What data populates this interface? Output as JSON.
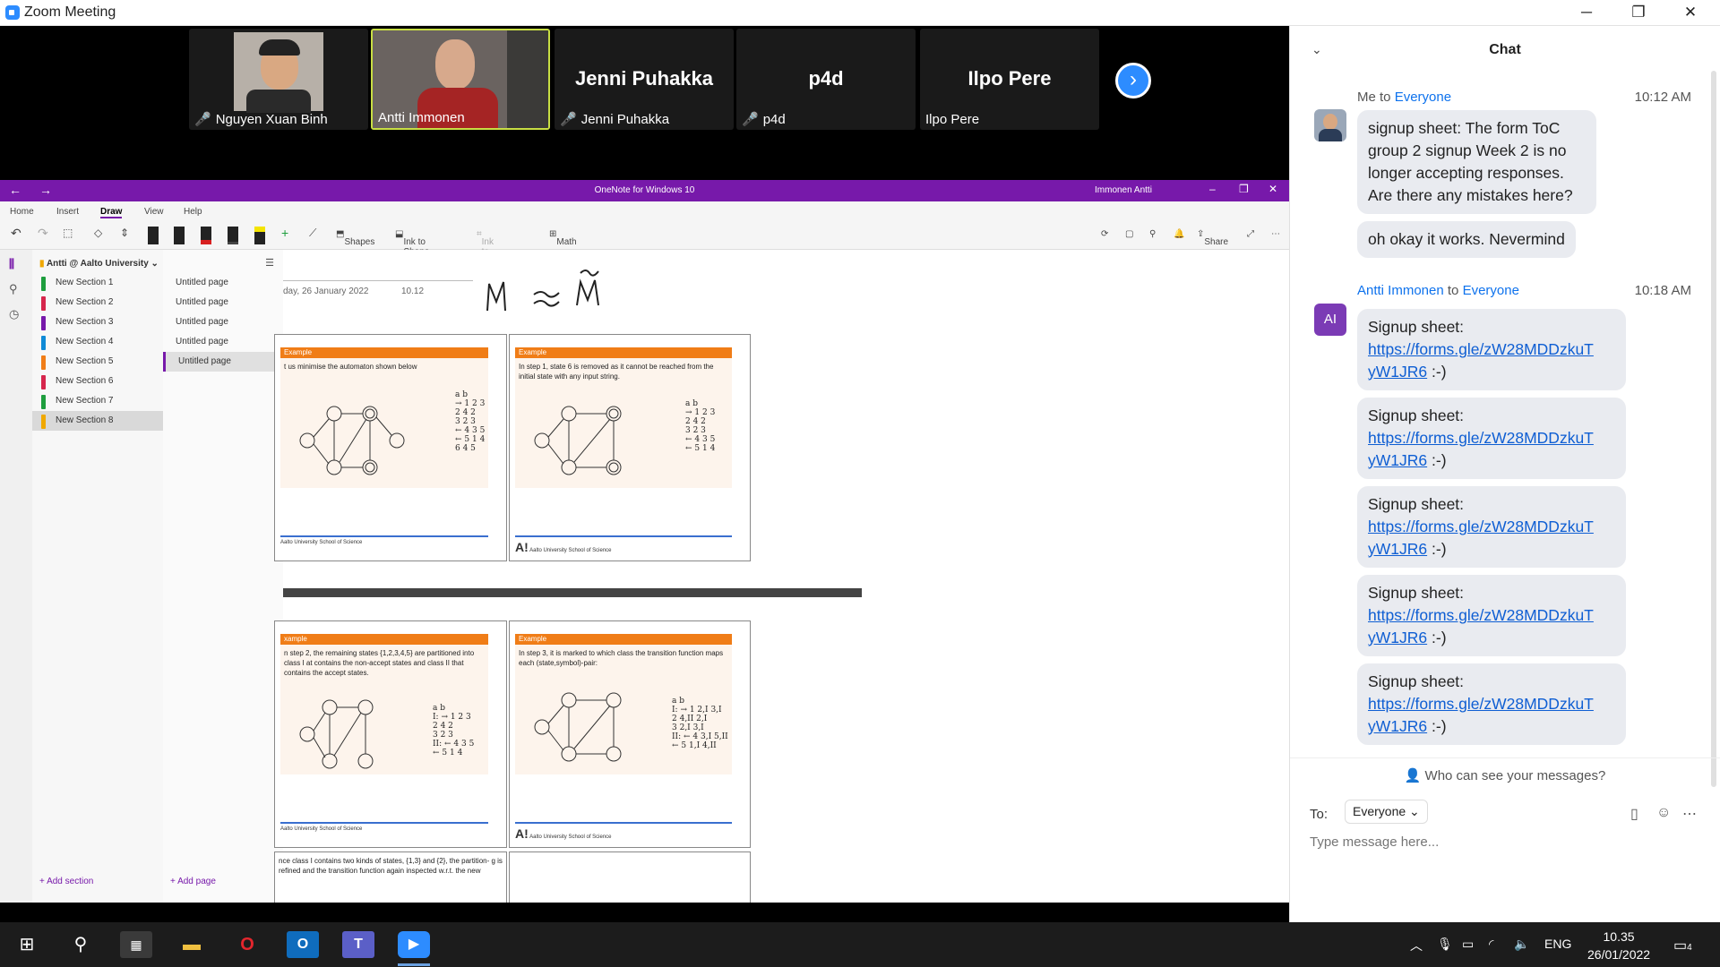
{
  "window": {
    "title": "Zoom Meeting",
    "min": "─",
    "max": "❐",
    "close": "✕"
  },
  "participants": [
    {
      "name": "Nguyen Xuan Binh",
      "display": "",
      "muted": true,
      "video": true
    },
    {
      "name": "Antti Immonen",
      "display": "",
      "muted": false,
      "video": true
    },
    {
      "name": "Jenni Puhakka",
      "display": "Jenni Puhakka",
      "muted": true,
      "video": false
    },
    {
      "name": "p4d",
      "display": "p4d",
      "muted": true,
      "video": false
    },
    {
      "name": "Ilpo Pere",
      "display": "Ilpo Pere",
      "muted": false,
      "video": false
    }
  ],
  "onenote": {
    "title": "OneNote for Windows 10",
    "user": "Immonen Antti",
    "menu": [
      "Home",
      "Insert",
      "Draw",
      "View",
      "Help"
    ],
    "tools": {
      "shapes": "Shapes",
      "ink_to_shape": "Ink to Shape",
      "ink_to_text": "Ink to Text",
      "math": "Math",
      "share": "Share"
    },
    "notebook": "Antti @ Aalto University",
    "sections": [
      "New Section 1",
      "New Section 2",
      "New Section 3",
      "New Section 4",
      "New Section 5",
      "New Section 6",
      "New Section 7",
      "New Section 8"
    ],
    "section_colors": [
      "#1e9e3e",
      "#d6264c",
      "#7719aa",
      "#0f8ad6",
      "#f07d17",
      "#d6264c",
      "#1e9e3e",
      "#f0a800"
    ],
    "pages": [
      "Untitled page",
      "Untitled page",
      "Untitled page",
      "Untitled page",
      "Untitled page"
    ],
    "add_section": "Add section",
    "add_page": "Add page",
    "date": "day, 26 January 2022",
    "time": "10.12",
    "slides": [
      {
        "header": "Example",
        "text": "t us minimise the automaton shown below"
      },
      {
        "header": "Example",
        "text": "In step 1, state 6 is removed as it cannot be reached from the initial state with any input string."
      },
      {
        "header": "xample",
        "text": "n step 2, the remaining states {1,2,3,4,5} are partitioned into class I at contains the non-accept states and class II that contains the accept states."
      },
      {
        "header": "Example",
        "text": "In step 3, it is marked to which class the transition function maps each (state,symbol)-pair:"
      }
    ],
    "bottom_text": "nce class I contains two kinds of states, {1,3} and {2}, the partition- g is refined and the transition function again inspected w.r.t. the new",
    "footer": "Aalto University School of Science"
  },
  "chat": {
    "title": "Chat",
    "messages": [
      {
        "from": "Me",
        "to": "Everyone",
        "time": "10:12 AM",
        "texts": [
          "signup sheet: The form ToC group 2 signup Week 2 is no longer accepting responses. Are there any mistakes here?",
          "oh okay it works. Nevermind"
        ]
      },
      {
        "from": "Antti Immonen",
        "to": "Everyone",
        "time": "10:18 AM",
        "initials": "AI",
        "prefix": "Signup sheet:",
        "link": "https://forms.gle/zW28MDDzkuTyW1JR6",
        "link_a": "https://forms.gle/zW28MDDzkuT",
        "link_b": "yW1JR6",
        "suffix": ":-)",
        "count": 5
      }
    ],
    "connector": "to",
    "who_can": "Who can see your messages?",
    "to_label": "To:",
    "to_value": "Everyone",
    "placeholder": "Type message here..."
  },
  "taskbar": {
    "lang": "ENG",
    "time": "10.35",
    "date": "26/01/2022",
    "notif": "4"
  }
}
